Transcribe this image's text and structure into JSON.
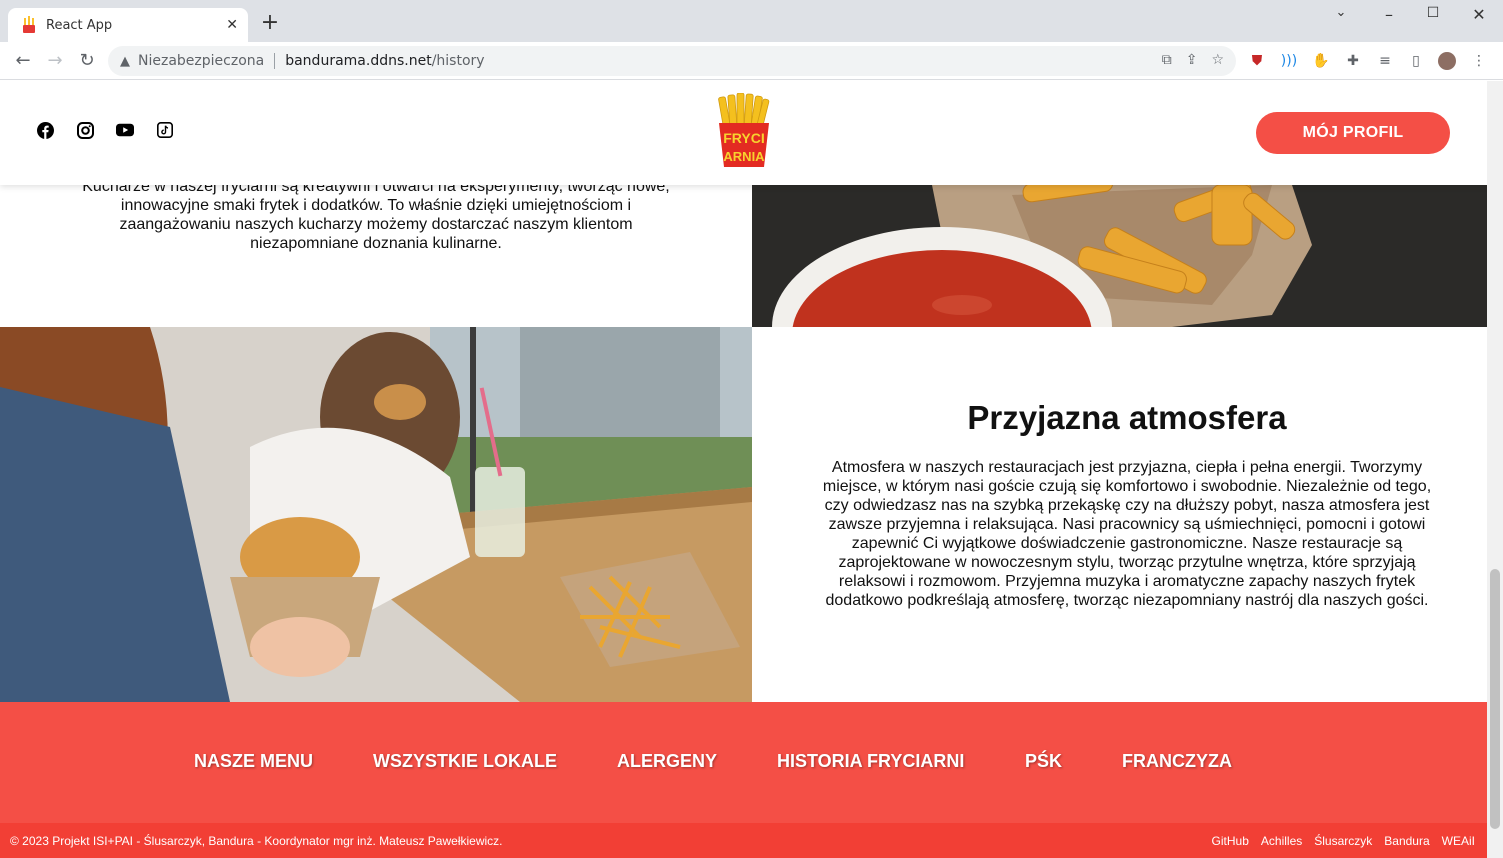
{
  "browser": {
    "tab_title": "React App",
    "tab_close": "✕",
    "new_tab": "+",
    "security_label": "Niezabezpieczona",
    "url_host": "bandurama.ddns.net",
    "url_path": "/history"
  },
  "header": {
    "socials": [
      "facebook-icon",
      "instagram-icon",
      "youtube-icon",
      "tiktok-icon"
    ],
    "logo_top": "FRYCI",
    "logo_bottom": "ARNIA",
    "profile_button": "MÓJ PROFIL"
  },
  "section_chefs": {
    "text": "Kucharze w naszej fryciarni są kreatywni i otwarci na eksperymenty, tworząc nowe, innowacyjne smaki frytek i dodatków. To właśnie dzięki umiejętnościom i zaangażowaniu naszych kucharzy możemy dostarczać naszym klientom niezapomniane doznania kulinarne."
  },
  "section_atmosphere": {
    "title": "Przyjazna atmosfera",
    "text": "Atmosfera w naszych restauracjach jest przyjazna, ciepła i pełna energii. Tworzymy miejsce, w którym nasi goście czują się komfortowo i swobodnie. Niezależnie od tego, czy odwiedzasz nas na szybką przekąskę czy na dłuższy pobyt, nasza atmosfera jest zawsze przyjemna i relaksująca. Nasi pracownicy są uśmiechnięci, pomocni i gotowi zapewnić Ci wyjątkowe doświadczenie gastronomiczne. Nasze restauracje są zaprojektowane w nowoczesnym stylu, tworząc przytulne wnętrza, które sprzyjają relaksowi i rozmowom. Przyjemna muzyka i aromatyczne zapachy naszych frytek dodatkowo podkreślają atmosferę, tworząc niezapomniany nastrój dla naszych gości."
  },
  "footer": {
    "nav": [
      "NASZE MENU",
      "WSZYSTKIE LOKALE",
      "ALERGENY",
      "HISTORIA FRYCIARNI",
      "PŚK",
      "FRANCZYZA"
    ],
    "copyright": "© 2023 Projekt ISI+PAI - Ślusarczyk, Bandura - Koordynator mgr inż. Mateusz Pawełkiewicz.",
    "links": [
      "GitHub",
      "Achilles",
      "Ślusarczyk",
      "Bandura",
      "WEAiI"
    ]
  },
  "colors": {
    "brand_red": "#f44f46",
    "footer_bar": "#f23f35"
  }
}
